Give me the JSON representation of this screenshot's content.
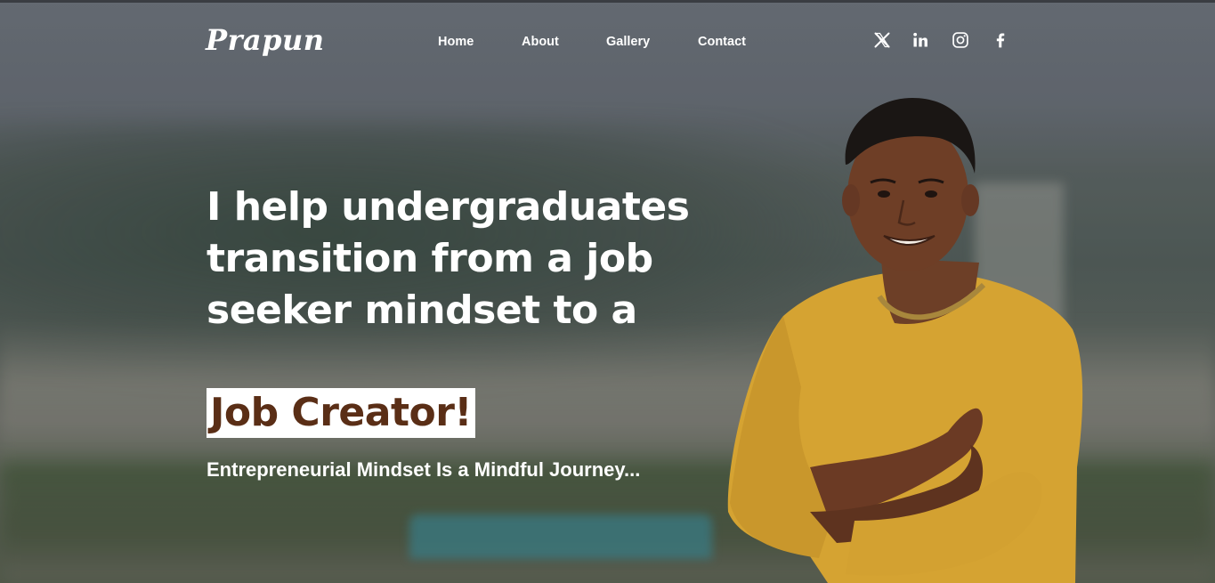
{
  "brand": {
    "logo_text": "Prapun"
  },
  "nav": {
    "items": [
      {
        "label": "Home"
      },
      {
        "label": "About"
      },
      {
        "label": "Gallery"
      },
      {
        "label": "Contact"
      }
    ]
  },
  "social": [
    {
      "icon": "x-twitter-icon"
    },
    {
      "icon": "linkedin-icon"
    },
    {
      "icon": "instagram-icon"
    },
    {
      "icon": "facebook-icon"
    }
  ],
  "hero": {
    "headline": "I help undergraduates transition from a job seeker mindset to a",
    "highlight": "Job Creator!",
    "tagline": "Entrepreneurial Mindset Is a Mindful Journey..."
  },
  "colors": {
    "highlight_text": "#5a2e16",
    "highlight_bg": "#ffffff",
    "sweater": "#d9a733",
    "nav_text": "#ffffff"
  }
}
